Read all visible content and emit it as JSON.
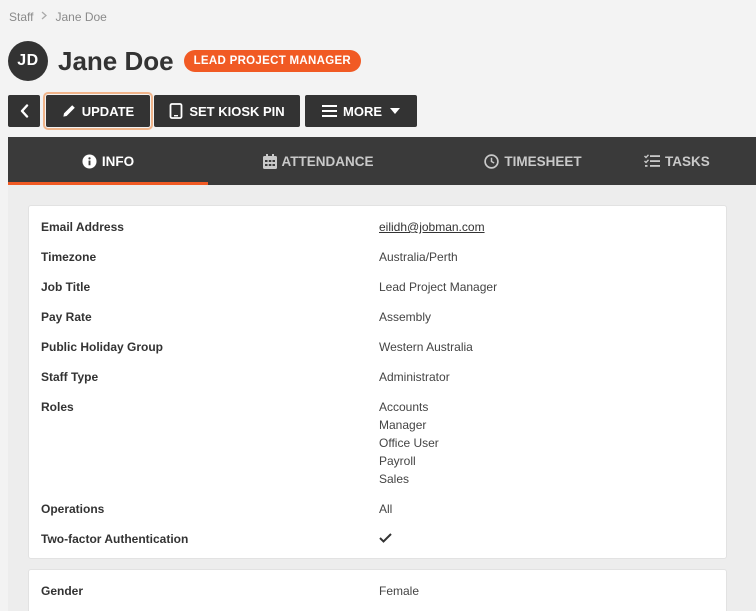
{
  "breadcrumb": {
    "parent": "Staff",
    "current": "Jane Doe"
  },
  "header": {
    "avatar_initials": "JD",
    "name": "Jane Doe",
    "role_badge": "LEAD PROJECT MANAGER"
  },
  "toolbar": {
    "update_label": "UPDATE",
    "kiosk_label": "SET KIOSK PIN",
    "more_label": "MORE"
  },
  "tabs": [
    {
      "label": "INFO",
      "icon": "info-icon",
      "active": true
    },
    {
      "label": "ATTENDANCE",
      "icon": "calendar-icon"
    },
    {
      "label": "TIMESHEET",
      "icon": "clock-icon"
    },
    {
      "label": "TASKS",
      "icon": "checklist-icon"
    }
  ],
  "info": {
    "email": {
      "label": "Email Address",
      "value": "eilidh@jobman.com"
    },
    "timezone": {
      "label": "Timezone",
      "value": "Australia/Perth"
    },
    "job_title": {
      "label": "Job Title",
      "value": "Lead Project Manager"
    },
    "pay_rate": {
      "label": "Pay Rate",
      "value": "Assembly"
    },
    "holiday_group": {
      "label": "Public Holiday Group",
      "value": "Western Australia"
    },
    "staff_type": {
      "label": "Staff Type",
      "value": "Administrator"
    },
    "roles": {
      "label": "Roles",
      "values": [
        "Accounts",
        "Manager",
        "Office User",
        "Payroll",
        "Sales"
      ]
    },
    "operations": {
      "label": "Operations",
      "value": "All"
    },
    "two_factor": {
      "label": "Two-factor Authentication",
      "enabled": true,
      "icon": "check-icon"
    }
  },
  "personal": {
    "gender": {
      "label": "Gender",
      "value": "Female"
    }
  },
  "colors": {
    "accent": "#f15a24",
    "dark": "#333333",
    "tabbar": "#3a3a3a"
  }
}
